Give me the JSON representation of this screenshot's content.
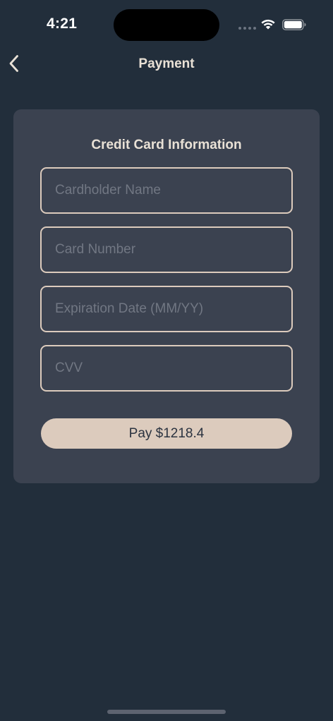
{
  "status_bar": {
    "time": "4:21",
    "wifi_icon": "wifi-icon",
    "battery_icon": "battery-icon"
  },
  "nav": {
    "title": "Payment",
    "back_icon": "chevron-left-icon"
  },
  "card": {
    "title": "Credit Card Information",
    "fields": [
      {
        "placeholder": "Cardholder Name",
        "value": ""
      },
      {
        "placeholder": "Card Number",
        "value": ""
      },
      {
        "placeholder": "Expiration Date (MM/YY)",
        "value": ""
      },
      {
        "placeholder": "CVV",
        "value": ""
      }
    ],
    "pay_label": "Pay $1218.4"
  },
  "colors": {
    "background": "#222e3b",
    "panel": "#3b4250",
    "accent": "#dccbbd",
    "text": "#e9e1d6",
    "placeholder": "#717783"
  }
}
